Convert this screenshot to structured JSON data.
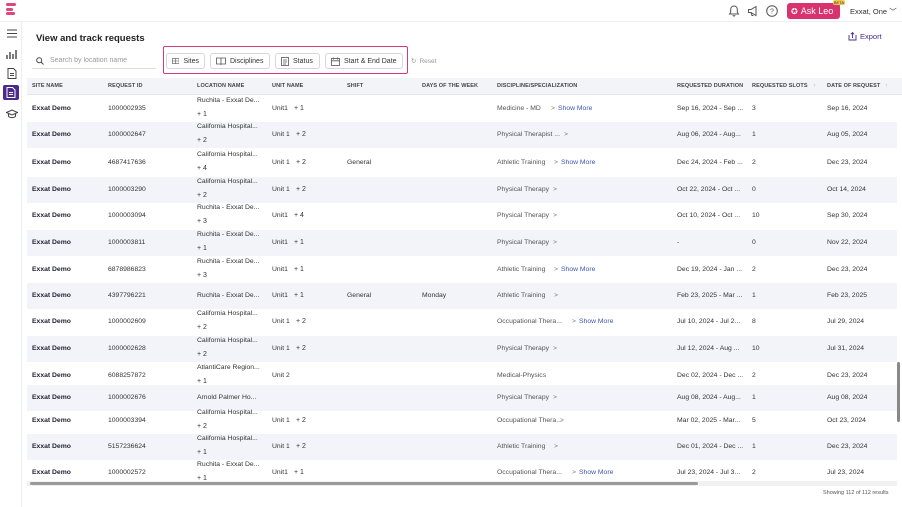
{
  "header": {
    "user_label": "Exxat, One",
    "ask_leo_label": "Ask Leo",
    "ask_leo_badge": "BETA",
    "icons": [
      "bell-icon",
      "megaphone-icon",
      "help-icon"
    ]
  },
  "page": {
    "title": "View and track requests",
    "export_label": "Export"
  },
  "toolbar": {
    "search_placeholder": "Search by location name",
    "filters": [
      "Sites",
      "Disciplines",
      "Status",
      "Start & End Date"
    ],
    "reset_label": "Reset"
  },
  "table": {
    "columns": [
      "SITE NAME",
      "REQUEST ID",
      "LOCATION NAME",
      "UNIT NAME",
      "SHIFT",
      "DAYS OF THE WEEK",
      "DISCIPLINE/SPECIALIZATION",
      "REQUESTED DURATION",
      "REQUESTED SLOTS",
      "DATE OF REQUEST"
    ],
    "rows": [
      {
        "site": "Exxat Demo",
        "id": "1000002935",
        "loc": "Ruchita - Exxat De...",
        "loc_more": "+ 1",
        "unit": "Unit1",
        "unit_more": "+ 1",
        "shift": "",
        "days": "",
        "disc": "Medicine - MD",
        "show_more": "Show More",
        "duration": "Sep 16, 2024 - Sep ...",
        "slots": "3",
        "date": "Sep 16, 2024"
      },
      {
        "site": "Exxat Demo",
        "id": "1000002647",
        "loc": "California Hospital...",
        "loc_more": "+ 2",
        "unit": "Unit 1",
        "unit_more": "+ 2",
        "shift": "",
        "days": "",
        "disc": "Physical Therapist ...",
        "show_more": "",
        "duration": "Aug 06, 2024 - Aug...",
        "slots": "1",
        "date": "Aug 05, 2024"
      },
      {
        "site": "Exxat Demo",
        "id": "4687417636",
        "loc": "California Hospital...",
        "loc_more": "+ 4",
        "unit": "Unit 1",
        "unit_more": "+ 2",
        "shift": "General",
        "days": "",
        "disc": "Athletic Training",
        "show_more": "Show More",
        "duration": "Dec 24, 2024 - Feb ...",
        "slots": "2",
        "date": "Dec 23, 2024"
      },
      {
        "site": "Exxat Demo",
        "id": "1000003290",
        "loc": "California Hospital...",
        "loc_more": "+ 2",
        "unit": "Unit 1",
        "unit_more": "+ 2",
        "shift": "",
        "days": "",
        "disc": "Physical Therapy",
        "show_more": "",
        "duration": "Oct 22, 2024 - Oct ...",
        "slots": "0",
        "date": "Oct 14, 2024"
      },
      {
        "site": "Exxat Demo",
        "id": "1000003094",
        "loc": "Ruchita - Exxat De...",
        "loc_more": "+ 3",
        "unit": "Unit1",
        "unit_more": "+ 4",
        "shift": "",
        "days": "",
        "disc": "Physical Therapy",
        "show_more": "",
        "duration": "Oct 10, 2024 - Oct ...",
        "slots": "10",
        "date": "Sep 30, 2024"
      },
      {
        "site": "Exxat Demo",
        "id": "1000003811",
        "loc": "Ruchita - Exxat De...",
        "loc_more": "+ 1",
        "unit": "Unit1",
        "unit_more": "+ 1",
        "shift": "",
        "days": "",
        "disc": "Physical Therapy",
        "show_more": "",
        "duration": "-",
        "slots": "0",
        "date": "Nov 22, 2024"
      },
      {
        "site": "Exxat Demo",
        "id": "6878986823",
        "loc": "Ruchita - Exxat De...",
        "loc_more": "+ 3",
        "unit": "Unit1",
        "unit_more": "+ 1",
        "shift": "",
        "days": "",
        "disc": "Athletic Training",
        "show_more": "Show More",
        "duration": "Dec 19, 2024 - Jan ...",
        "slots": "2",
        "date": "Dec 23, 2024"
      },
      {
        "site": "Exxat Demo",
        "id": "4397796221",
        "loc": "Ruchita - Exxat De...",
        "loc_more": "",
        "unit": "Unit1",
        "unit_more": "+ 1",
        "shift": "General",
        "days": "Monday",
        "disc": "Athletic Training",
        "show_more": "",
        "duration": "Feb 23, 2025 - Mar ...",
        "slots": "1",
        "date": "Feb 23, 2025"
      },
      {
        "site": "Exxat Demo",
        "id": "1000002609",
        "loc": "California Hospital...",
        "loc_more": "+ 2",
        "unit": "Unit 1",
        "unit_more": "+ 2",
        "shift": "",
        "days": "",
        "disc": "Occupational Thera...",
        "show_more": "Show More",
        "duration": "Jul 10, 2024 - Jul 2...",
        "slots": "8",
        "date": "Jul 29, 2024"
      },
      {
        "site": "Exxat Demo",
        "id": "1000002628",
        "loc": "California Hospital...",
        "loc_more": "+ 2",
        "unit": "Unit 1",
        "unit_more": "+ 2",
        "shift": "",
        "days": "",
        "disc": "Physical Therapy",
        "show_more": "",
        "duration": "Jul 12, 2024 - Aug ...",
        "slots": "10",
        "date": "Jul 31, 2024"
      },
      {
        "site": "Exxat Demo",
        "id": "6088257872",
        "loc": "AtlantiCare Region...",
        "loc_more": "+ 1",
        "unit": "Unit 2",
        "unit_more": "",
        "shift": "",
        "days": "",
        "disc": "Medical-Physics",
        "show_more": "",
        "duration": "Dec 02, 2024 - Dec ...",
        "slots": "2",
        "date": "Dec 23, 2024"
      },
      {
        "site": "Exxat Demo",
        "id": "1000002676",
        "loc": "Arnold Palmer Ho...",
        "loc_more": "",
        "unit": "",
        "unit_more": "",
        "shift": "",
        "days": "",
        "disc": "Physical Therapy",
        "show_more": "",
        "duration": "Aug 08, 2024 - Aug...",
        "slots": "1",
        "date": "Aug 08, 2024"
      },
      {
        "site": "Exxat Demo",
        "id": "1000003394",
        "loc": "California Hospital...",
        "loc_more": "+ 2",
        "unit": "Unit 1",
        "unit_more": "+ 2",
        "shift": "",
        "days": "",
        "disc": "Occupational Thera...",
        "show_more": "",
        "duration": "Mar 02, 2025 - Mar...",
        "slots": "5",
        "date": "Oct 23, 2024"
      },
      {
        "site": "Exxat Demo",
        "id": "5157236624",
        "loc": "California Hospital...",
        "loc_more": "+ 1",
        "unit": "Unit 1",
        "unit_more": "+ 2",
        "shift": "",
        "days": "",
        "disc": "Athletic Training",
        "show_more": "",
        "duration": "Dec 01, 2024 - Dec ...",
        "slots": "1",
        "date": "Dec 23, 2024"
      },
      {
        "site": "Exxat Demo",
        "id": "1000002572",
        "loc": "Ruchita - Exxat De...",
        "loc_more": "+ 1",
        "unit": "Unit1",
        "unit_more": "+ 1",
        "shift": "",
        "days": "",
        "disc": "Occupational Thera...",
        "show_more": "Show More",
        "duration": "Jul 23, 2024 - Jul 3...",
        "slots": "2",
        "date": "Jul 23, 2024"
      }
    ],
    "results_text": "Showing 112 of 112 results"
  },
  "colors": {
    "accent": "#d8336f",
    "brand_purple": "#4a2b8c",
    "link_blue": "#3f54b9",
    "row_alt": "#f3f4fa"
  }
}
